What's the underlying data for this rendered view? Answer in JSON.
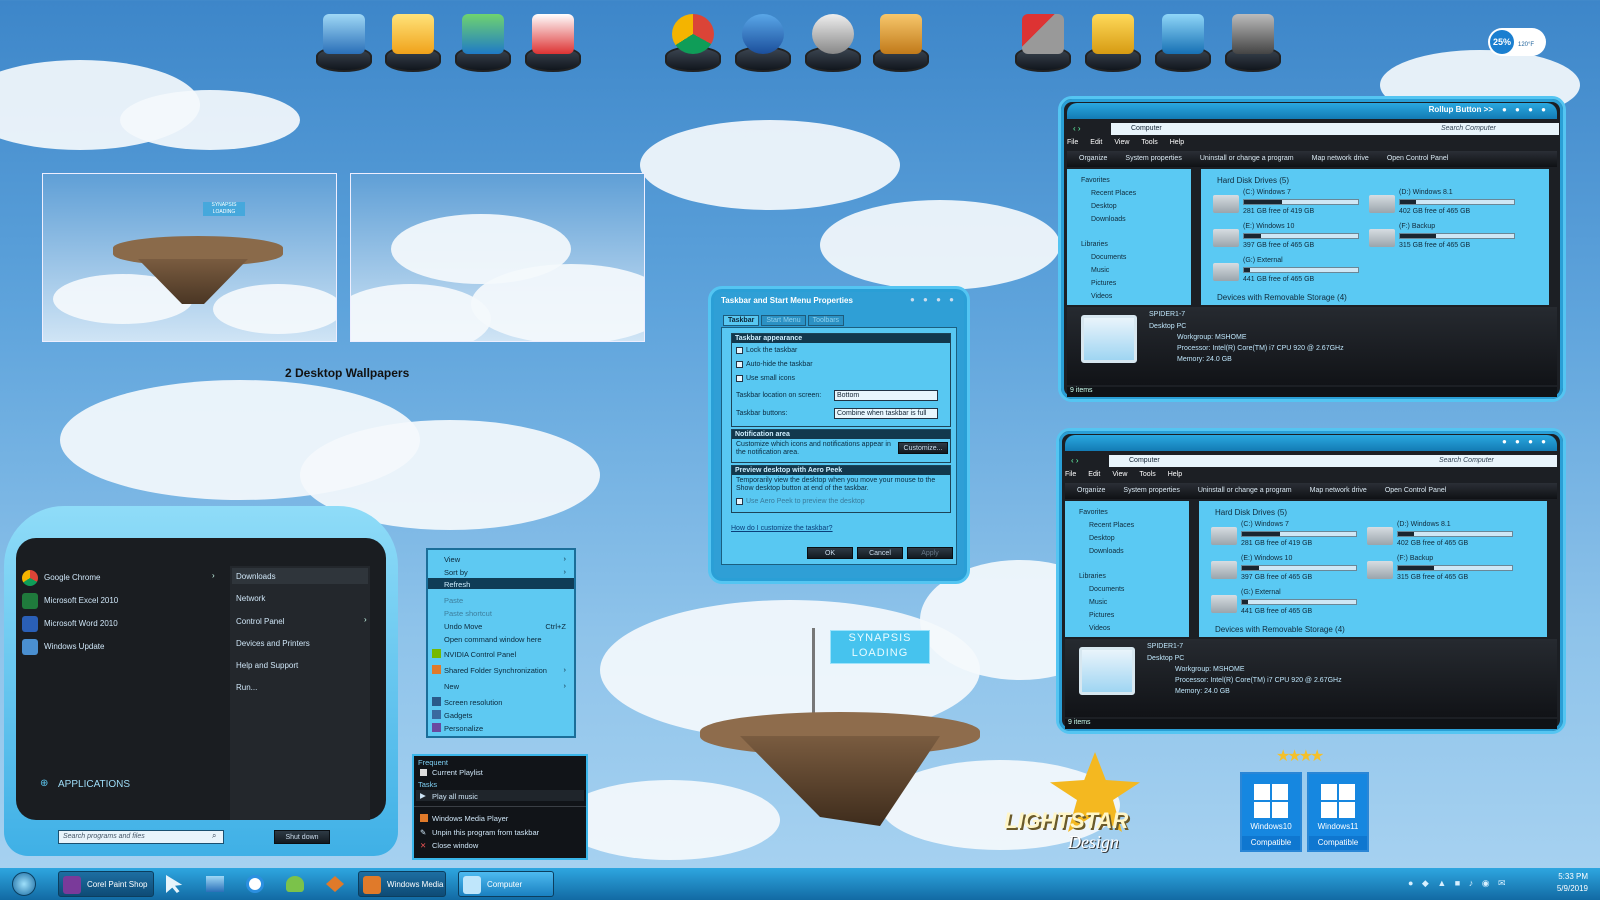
{
  "wallpapers": {
    "caption": "2 Desktop Wallpapers",
    "preview_flag": "SYNAPSIS LOADING"
  },
  "weather": {
    "percent": "25%",
    "temp": "120°F"
  },
  "explorer": {
    "rollup": "Rollup Button >>",
    "address": "Computer",
    "search_placeholder": "Search Computer",
    "menu": [
      "File",
      "Edit",
      "View",
      "Tools",
      "Help"
    ],
    "commands": [
      "Organize",
      "System properties",
      "Uninstall or change a program",
      "Map network drive",
      "Open Control Panel"
    ],
    "nav": [
      "Favorites",
      "Recent Places",
      "Desktop",
      "Downloads",
      "Libraries",
      "Documents",
      "Music",
      "Pictures",
      "Videos"
    ],
    "hdd_header": "Hard Disk Drives (5)",
    "removable_header": "Devices with Removable Storage (4)",
    "drives": [
      {
        "name": "(C:) Windows 7",
        "free": "281 GB free of 419 GB",
        "used": 0.33
      },
      {
        "name": "(D:) Windows 8.1",
        "free": "402 GB free of 465 GB",
        "used": 0.14
      },
      {
        "name": "(E:) Windows 10",
        "free": "397 GB free of 465 GB",
        "used": 0.15
      },
      {
        "name": "(F:) Backup",
        "free": "315 GB free of 465 GB",
        "used": 0.32
      },
      {
        "name": "(G:) External",
        "free": "441 GB free of 465 GB",
        "used": 0.05
      }
    ],
    "pc_name": "SPIDER1-7",
    "pc_type": "Desktop PC",
    "workgroup": "Workgroup: MSHOME",
    "processor": "Processor: Intel(R) Core(TM) i7 CPU       920 @ 2.67GHz",
    "memory": "Memory: 24.0 GB",
    "status": "9 items"
  },
  "dialog": {
    "title": "Taskbar and Start Menu Properties",
    "tabs": [
      "Taskbar",
      "Start Menu",
      "Toolbars"
    ],
    "appearance_hd": "Taskbar appearance",
    "lock": "Lock the taskbar",
    "autohide": "Auto-hide the taskbar",
    "small": "Use small icons",
    "location_label": "Taskbar location on screen:",
    "location_value": "Bottom",
    "buttons_label": "Taskbar buttons:",
    "buttons_value": "Combine when taskbar is full",
    "notif_hd": "Notification area",
    "notif_text": "Customize which icons and notifications appear in the notification area.",
    "customize": "Customize...",
    "peek_hd": "Preview desktop with Aero Peek",
    "peek_text": "Temporarily view the desktop when you move your mouse to the Show desktop button at end of the taskbar.",
    "peek_cb": "Use Aero Peek to preview the desktop",
    "link": "How do I customize the taskbar?",
    "ok": "OK",
    "cancel": "Cancel",
    "apply": "Apply"
  },
  "startmenu": {
    "apps": [
      "Google Chrome",
      "Microsoft Excel 2010",
      "Microsoft Word 2010",
      "Windows Update"
    ],
    "right": [
      "Downloads",
      "Network",
      "Control Panel",
      "Devices and Printers",
      "Help and Support",
      "Run..."
    ],
    "all": "APPLICATIONS",
    "search_placeholder": "Search programs and files",
    "shutdown": "Shut down"
  },
  "context": {
    "items": [
      "View",
      "Sort by",
      "Refresh",
      "Paste",
      "Paste shortcut",
      "Undo Move",
      "Open command window here",
      "NVIDIA Control Panel",
      "Shared Folder Synchronization",
      "New",
      "Screen resolution",
      "Gadgets",
      "Personalize"
    ],
    "undo_key": "Ctrl+Z"
  },
  "jumplist": {
    "frequent": "Frequent",
    "current": "Current Playlist",
    "tasks": "Tasks",
    "play": "Play all music",
    "wmp": "Windows Media Player",
    "unpin": "Unpin this program from taskbar",
    "close": "Close window"
  },
  "island_flag": {
    "line1": "SYNAPSIS",
    "line2": "LOADING"
  },
  "brand": {
    "line1": "LIGHTSTAR",
    "line2": "Design"
  },
  "badges": {
    "win10": "Windows10",
    "win11": "Windows11",
    "compat": "Compatible"
  },
  "taskbar": {
    "corel": "Corel Paint Shop ...",
    "wmp": "Windows Media ...",
    "computer": "Computer",
    "time": "5:33 PM",
    "date": "5/9/2019"
  },
  "colors": {
    "accent": "#58c8f2",
    "dark": "#15181c"
  }
}
